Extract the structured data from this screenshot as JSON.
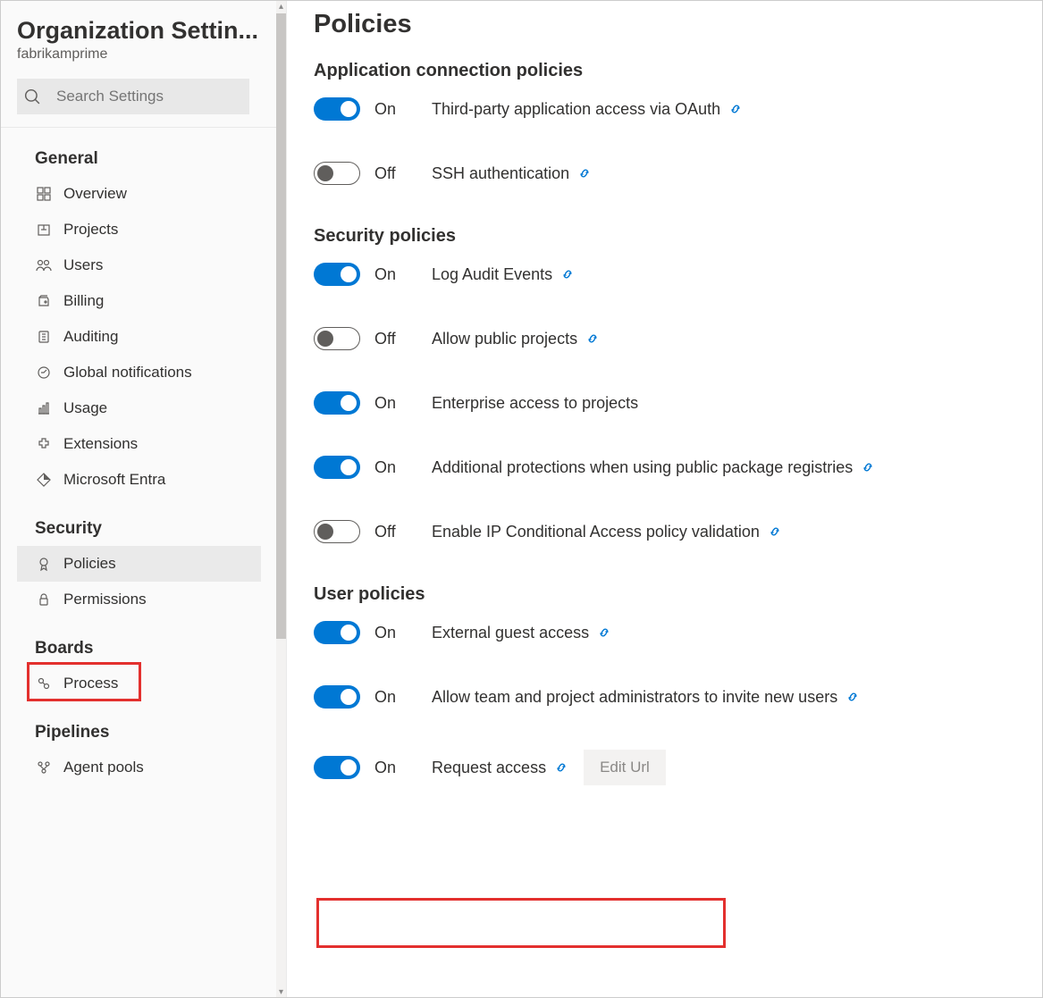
{
  "sidebar": {
    "title": "Organization Settin...",
    "subtitle": "fabrikamprime",
    "search_placeholder": "Search Settings",
    "groups": [
      {
        "heading": "General",
        "items": [
          {
            "icon": "overview",
            "label": "Overview",
            "selected": false
          },
          {
            "icon": "projects",
            "label": "Projects",
            "selected": false
          },
          {
            "icon": "users",
            "label": "Users",
            "selected": false
          },
          {
            "icon": "billing",
            "label": "Billing",
            "selected": false
          },
          {
            "icon": "auditing",
            "label": "Auditing",
            "selected": false
          },
          {
            "icon": "notifications",
            "label": "Global notifications",
            "selected": false
          },
          {
            "icon": "usage",
            "label": "Usage",
            "selected": false
          },
          {
            "icon": "extensions",
            "label": "Extensions",
            "selected": false
          },
          {
            "icon": "entra",
            "label": "Microsoft Entra",
            "selected": false
          }
        ]
      },
      {
        "heading": "Security",
        "items": [
          {
            "icon": "policies",
            "label": "Policies",
            "selected": true
          },
          {
            "icon": "permissions",
            "label": "Permissions",
            "selected": false
          }
        ]
      },
      {
        "heading": "Boards",
        "items": [
          {
            "icon": "process",
            "label": "Process",
            "selected": false
          }
        ]
      },
      {
        "heading": "Pipelines",
        "items": [
          {
            "icon": "agent-pools",
            "label": "Agent pools",
            "selected": false
          }
        ]
      }
    ]
  },
  "main": {
    "title": "Policies",
    "sections": [
      {
        "heading": "Application connection policies",
        "policies": [
          {
            "on": true,
            "label": "Third-party application access via OAuth",
            "link": true,
            "button": null
          },
          {
            "on": false,
            "label": "SSH authentication",
            "link": true,
            "button": null
          }
        ]
      },
      {
        "heading": "Security policies",
        "policies": [
          {
            "on": true,
            "label": "Log Audit Events",
            "link": true,
            "button": null
          },
          {
            "on": false,
            "label": "Allow public projects",
            "link": true,
            "button": null
          },
          {
            "on": true,
            "label": "Enterprise access to projects",
            "link": false,
            "button": null
          },
          {
            "on": true,
            "label": "Additional protections when using public package registries",
            "link": true,
            "button": null
          },
          {
            "on": false,
            "label": "Enable IP Conditional Access policy validation",
            "link": true,
            "button": null
          }
        ]
      },
      {
        "heading": "User policies",
        "policies": [
          {
            "on": true,
            "label": "External guest access",
            "link": true,
            "button": null
          },
          {
            "on": true,
            "label": "Allow team and project administrators to invite new users",
            "link": true,
            "button": null
          },
          {
            "on": true,
            "label": "Request access",
            "link": true,
            "button": "Edit Url"
          }
        ]
      }
    ],
    "toggle_labels": {
      "on": "On",
      "off": "Off"
    }
  }
}
